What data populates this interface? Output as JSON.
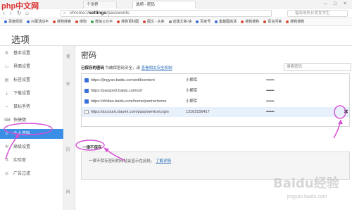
{
  "browser": {
    "tabs": [
      "个世界",
      "选项 - 密码"
    ],
    "url_prefix": "chrome://",
    "url_bold": "settings",
    "url_suffix": "/passwords",
    "search_placeholder": "福岛地热长爱女学生"
  },
  "bookmarks": [
    {
      "label": "百度经验",
      "color": "#3b6fd9"
    },
    {
      "label": "兴展活动平",
      "color": "#3b6fd9"
    },
    {
      "label": "搜狗搜索",
      "color": "#d94a3b"
    },
    {
      "label": "搜狗",
      "color": "#d94a3b"
    },
    {
      "label": "微信公众平",
      "color": "#3aa84a"
    },
    {
      "label": "搜狗百科图",
      "color": "#d94a3b"
    },
    {
      "label": "图文 - 头条",
      "color": "#d94a3b"
    },
    {
      "label": "创建文章-快",
      "color": "#888888"
    },
    {
      "label": "百家号",
      "color": "#3b6fd9"
    },
    {
      "label": "集截图高清",
      "color": "#3b6fd9"
    },
    {
      "label": "搜狗搜狗",
      "color": "#d94a3b"
    },
    {
      "label": "百合问答",
      "color": "#d94a3b"
    },
    {
      "label": "搜狗搜狗",
      "color": "#d94a3b"
    }
  ],
  "page": {
    "title": "选项"
  },
  "sidebar": {
    "items": [
      {
        "label": "基本设置",
        "icon": "gear-icon",
        "glyph": "⚙"
      },
      {
        "label": "界面设置",
        "icon": "layout-icon",
        "glyph": "▭"
      },
      {
        "label": "标签设置",
        "icon": "tag-icon",
        "glyph": "▤"
      },
      {
        "label": "下载设置",
        "icon": "download-icon",
        "glyph": "⤓"
      },
      {
        "label": "鼠标手势",
        "icon": "mouse-icon",
        "glyph": "⌁"
      },
      {
        "label": "快捷键",
        "icon": "keyboard-icon",
        "glyph": "⌨"
      },
      {
        "label": "个人资料",
        "icon": "user-icon",
        "glyph": "☺"
      },
      {
        "label": "高级设置",
        "icon": "advanced-icon",
        "glyph": "✲"
      },
      {
        "label": "实验室",
        "icon": "lab-icon",
        "glyph": "⚗"
      },
      {
        "label": "广告过滤",
        "icon": "filter-icon",
        "glyph": "⊘"
      }
    ],
    "active_index": 6
  },
  "under_letters": [
    "使",
    "安",
    "历",
    "网"
  ],
  "dialog": {
    "title": "密码",
    "saved_label": "已保存的密码",
    "saved_note": "为确保密码安全，请",
    "saved_link": "查看相关安全机制",
    "search_placeholder": "搜索密码",
    "rows": [
      {
        "url": "https://jingyan.baidu.com/edit/content",
        "user": "小颗军",
        "password": "••••••••",
        "icon": "paw",
        "selected": false
      },
      {
        "url": "https://passport.baidu.com/v2/",
        "user": "小颗军",
        "password": "••••••••",
        "icon": "paw",
        "selected": false
      },
      {
        "url": "https://zhidao.baidu.com/home/partnerhome",
        "user": "小颗军",
        "password": "••••••••",
        "icon": "paw",
        "selected": false
      },
      {
        "url": "https://account.xiaomi.com/pass/serviceLogin",
        "user": "13162156417",
        "password": "••••••••",
        "icon": "doc",
        "selected": true
      }
    ],
    "never_label": "一律不保存",
    "never_text": "一律不保存密码的网站会显示在此处。",
    "never_link": "了解详情"
  },
  "annotation_color": "#d64fd6",
  "watermark": {
    "logo_text": "php中文网",
    "baidu_text": "Baidu经验",
    "jingyan_text": "jingyan.baidu.com"
  }
}
